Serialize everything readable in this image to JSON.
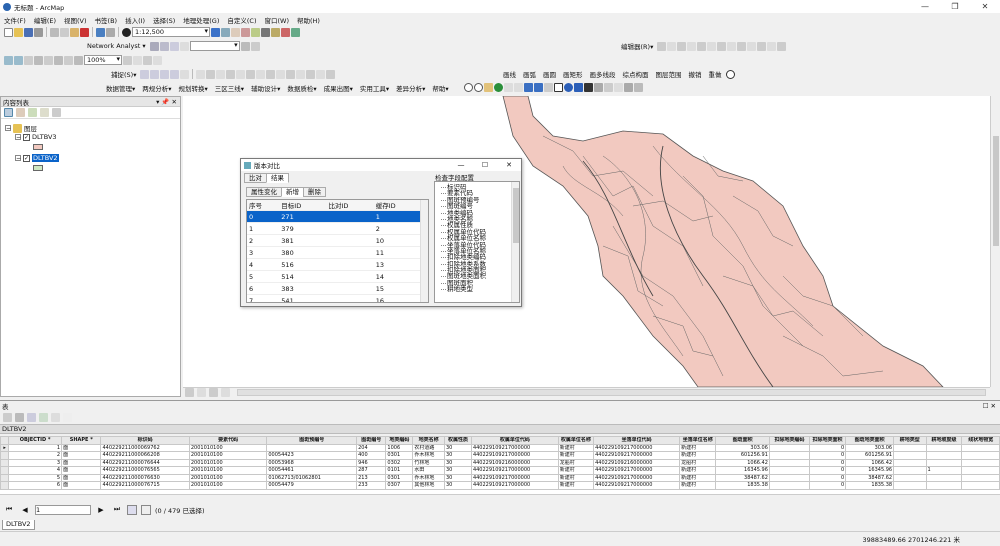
{
  "window": {
    "title": "无标题 - ArcMap",
    "controls": [
      "—",
      "❐",
      "✕"
    ]
  },
  "menu": [
    "文件(F)",
    "编辑(E)",
    "视图(V)",
    "书签(B)",
    "插入(I)",
    "选择(S)",
    "地理处理(G)",
    "自定义(C)",
    "窗口(W)",
    "帮助(H)"
  ],
  "toolbar": {
    "scale": "1:12,500",
    "network_analyst": "Network Analyst ▾",
    "editor": "编辑器(R)▾",
    "zoom": "100%",
    "capture": "捕捉(S)▾",
    "menus2": [
      "画线",
      "画弧",
      "画圆",
      "画矩形",
      "画多线段",
      "综点构面",
      "图层范围",
      "撤销",
      "重做"
    ],
    "menus3": [
      "数据管理▾",
      "两规分析▾",
      "规划转换▾",
      "三区三线▾",
      "辅助设计▾",
      "数据质检▾",
      "成果出图▾",
      "实用工具▾",
      "差异分析▾",
      "帮助▾"
    ]
  },
  "toc": {
    "title": "内容列表",
    "group": "图层",
    "layers": [
      {
        "name": "DLTBV3",
        "checked": true,
        "selected": false,
        "color": "#f2c9c0"
      },
      {
        "name": "DLTBV2",
        "checked": true,
        "selected": true,
        "color": "#cfe8c2"
      }
    ]
  },
  "dialog": {
    "title": "版本对比",
    "tabs": [
      "比对",
      "结果"
    ],
    "subtabs": [
      "属性变化",
      "新增",
      "删除"
    ],
    "field_label": "检查字段配置",
    "columns": [
      "序号",
      "目标ID",
      "比对ID",
      "缓存ID"
    ],
    "rows": [
      [
        "0",
        "271",
        "",
        "1"
      ],
      [
        "1",
        "379",
        "",
        "2"
      ],
      [
        "2",
        "381",
        "",
        "10"
      ],
      [
        "3",
        "380",
        "",
        "11"
      ],
      [
        "4",
        "516",
        "",
        "13"
      ],
      [
        "5",
        "514",
        "",
        "14"
      ],
      [
        "6",
        "383",
        "",
        "15"
      ],
      [
        "7",
        "541",
        "",
        "16"
      ]
    ],
    "fields": [
      "标识码",
      "要素代码",
      "图斑预编号",
      "图斑编号",
      "地类编码",
      "地类名称",
      "权属性质",
      "权属单位代码",
      "权属单位名称",
      "坐落单位代码",
      "坐落单位名称",
      "扣除地类编码",
      "扣除地类系数",
      "扣除地类面积",
      "图斑地类面积",
      "图斑面积",
      "耕地类型"
    ]
  },
  "table": {
    "title": "表",
    "layer": "DLTBV2",
    "columns": [
      "OBJECTID *",
      "SHAPE *",
      "标识码",
      "要素代码",
      "图斑预编号",
      "图斑编号",
      "地类编码",
      "地类名称",
      "权属性质",
      "权属单位代码",
      "权属单位名称",
      "坐落单位代码",
      "坐落单位名称",
      "图斑面积",
      "扣除地类编码",
      "扣除地类面积",
      "图斑地类面积",
      "耕地类型",
      "耕地坡度级",
      "线状地物宽"
    ],
    "rows": [
      [
        "1",
        "面",
        "440229211000069762",
        "2001010100",
        "",
        "204",
        "1006",
        "农村道路",
        "30",
        "440229109217000000",
        "新建村",
        "440229109217000000",
        "新建村",
        "303.06",
        "",
        "0",
        "303.06",
        "",
        "",
        ""
      ],
      [
        "2",
        "面",
        "440229211000066208",
        "2001010100",
        "00054423",
        "400",
        "0301",
        "乔木林地",
        "30",
        "440229109217000000",
        "新建村",
        "440229109217000000",
        "新建村",
        "601256.91",
        "",
        "0",
        "601256.91",
        "",
        "",
        ""
      ],
      [
        "3",
        "面",
        "440229211000076644",
        "2001010100",
        "00053968",
        "946",
        "0302",
        "竹林地",
        "30",
        "440229109216000000",
        "龙船村",
        "440229109216000000",
        "龙船村",
        "1066.42",
        "",
        "0",
        "1066.42",
        "",
        "",
        ""
      ],
      [
        "4",
        "面",
        "440229211000076565",
        "2001010100",
        "00054461",
        "287",
        "0101",
        "水田",
        "30",
        "440229109217000000",
        "新建村",
        "440229109217000000",
        "新建村",
        "16345.96",
        "",
        "0",
        "16345.96",
        "",
        "1",
        ""
      ],
      [
        "5",
        "面",
        "440229211000076630",
        "2001010100",
        "01062713/01062801",
        "213",
        "0301",
        "乔木林地",
        "30",
        "440229109217000000",
        "新建村",
        "440229109217000000",
        "新建村",
        "38487.62",
        "",
        "0",
        "38487.62",
        "",
        "",
        ""
      ],
      [
        "6",
        "面",
        "440229211000076715",
        "2001010100",
        "00054479",
        "233",
        "0307",
        "其他林地",
        "30",
        "440229109217000000",
        "新建村",
        "440229109217000000",
        "新建村",
        "1835.38",
        "",
        "0",
        "1835.38",
        "",
        "",
        ""
      ]
    ],
    "nav": {
      "position": "1",
      "count": "(0 / 479 已选择)"
    },
    "tab": "DLTBV2"
  },
  "status": {
    "coords": "39883489.66  2701246.221 米"
  }
}
